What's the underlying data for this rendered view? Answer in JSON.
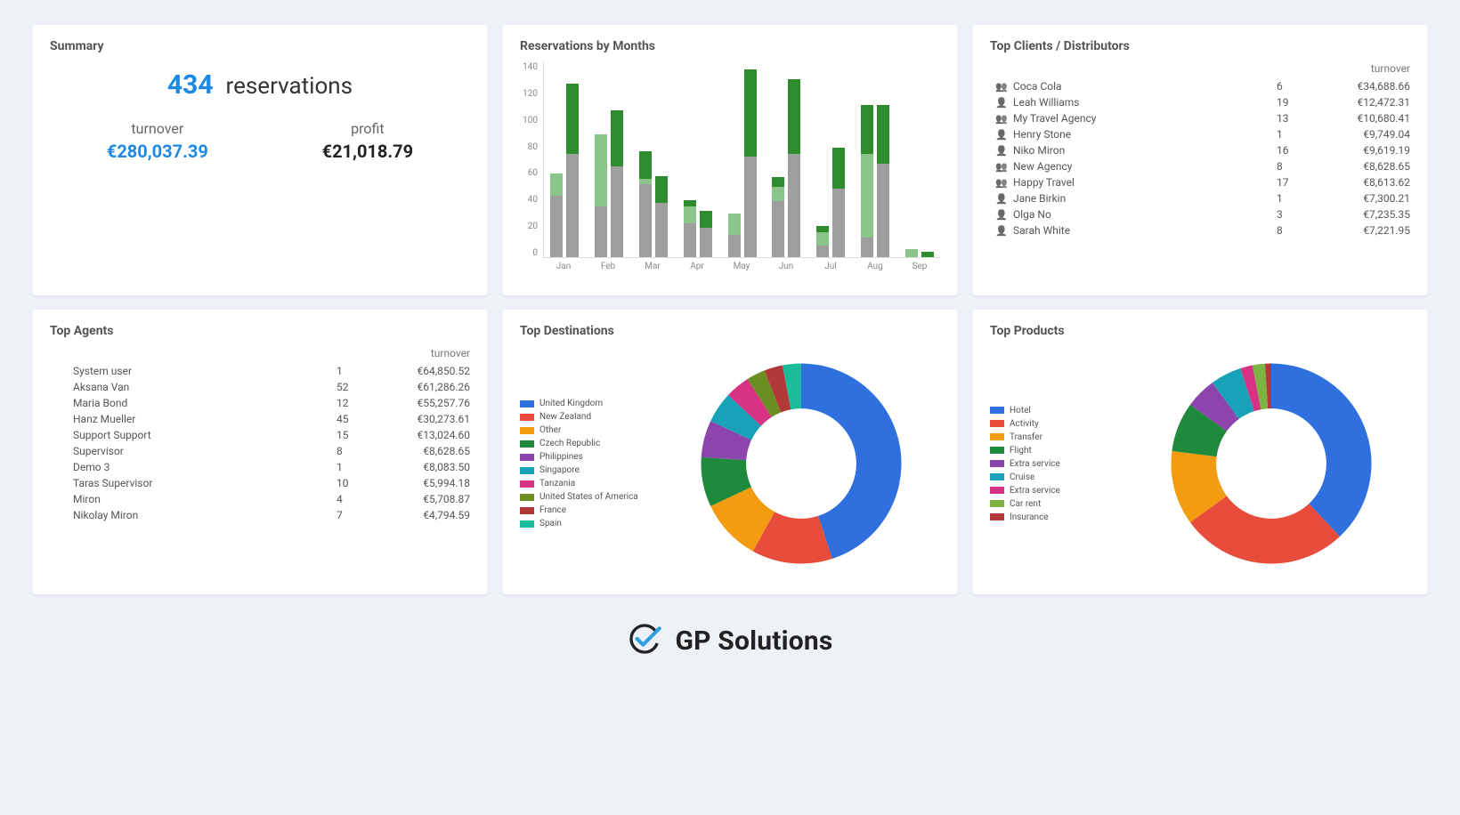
{
  "summary": {
    "title": "Summary",
    "reservations_count": "434",
    "reservations_label": "reservations",
    "turnover_label": "turnover",
    "turnover_value": "€280,037.39",
    "profit_label": "profit",
    "profit_value": "€21,018.79"
  },
  "reservations_chart_title": "Reservations by Months",
  "clients": {
    "title": "Top Clients / Distributors",
    "col_turnover": "turnover",
    "items": [
      {
        "icon": "people",
        "name": "Coca Cola",
        "count": "6",
        "turnover": "€34,688.66"
      },
      {
        "icon": "person",
        "name": "Leah Williams",
        "count": "19",
        "turnover": "€12,472.31"
      },
      {
        "icon": "people",
        "name": "My Travel Agency",
        "count": "13",
        "turnover": "€10,680.41"
      },
      {
        "icon": "person",
        "name": "Henry Stone",
        "count": "1",
        "turnover": "€9,749.04"
      },
      {
        "icon": "person",
        "name": "Niko Miron",
        "count": "16",
        "turnover": "€9,619.19"
      },
      {
        "icon": "people",
        "name": "New Agency",
        "count": "8",
        "turnover": "€8,628.65"
      },
      {
        "icon": "people",
        "name": "Happy Travel",
        "count": "17",
        "turnover": "€8,613.62"
      },
      {
        "icon": "person",
        "name": "Jane Birkin",
        "count": "1",
        "turnover": "€7,300.21"
      },
      {
        "icon": "person",
        "name": "Olga No",
        "count": "3",
        "turnover": "€7,235.35"
      },
      {
        "icon": "person",
        "name": "Sarah White",
        "count": "8",
        "turnover": "€7,221.95"
      }
    ]
  },
  "agents": {
    "title": "Top Agents",
    "col_turnover": "turnover",
    "items": [
      {
        "name": "System user",
        "count": "1",
        "turnover": "€64,850.52"
      },
      {
        "name": "Aksana Van",
        "count": "52",
        "turnover": "€61,286.26"
      },
      {
        "name": "Maria Bond",
        "count": "12",
        "turnover": "€55,257.76"
      },
      {
        "name": "Hanz Mueller",
        "count": "45",
        "turnover": "€30,273.61"
      },
      {
        "name": "Support Support",
        "count": "15",
        "turnover": "€13,024.60"
      },
      {
        "name": "Supervisor",
        "count": "8",
        "turnover": "€8,628.65"
      },
      {
        "name": "Demo 3",
        "count": "1",
        "turnover": "€8,083.50"
      },
      {
        "name": "Taras Supervisor",
        "count": "10",
        "turnover": "€5,994.18"
      },
      {
        "name": "Miron",
        "count": "4",
        "turnover": "€5,708.87"
      },
      {
        "name": "Nikolay Miron",
        "count": "7",
        "turnover": "€4,794.59"
      }
    ]
  },
  "destinations": {
    "title": "Top Destinations",
    "legend": [
      "United Kingdom",
      "New Zealand",
      "Other",
      "Czech Republic",
      "Philippines",
      "Singapore",
      "Tanzania",
      "United States of America",
      "France",
      "Spain"
    ]
  },
  "products": {
    "title": "Top Products",
    "legend": [
      "Hotel",
      "Activity",
      "Transfer",
      "Flight",
      "Extra service",
      "Cruise",
      "Extra service",
      "Car rent",
      "Insurance"
    ]
  },
  "footer_brand": "GP Solutions",
  "chart_data": [
    {
      "type": "bar",
      "title": "Reservations by Months",
      "xlabel": "",
      "ylabel": "",
      "ylim": [
        0,
        140
      ],
      "yticks": [
        0,
        20,
        40,
        60,
        80,
        100,
        120,
        140
      ],
      "categories": [
        "Jan",
        "Feb",
        "Mar",
        "Apr",
        "May",
        "Jun",
        "Jul",
        "Aug",
        "Sep"
      ],
      "stacked": true,
      "groups_per_category": 2,
      "series": [
        {
          "name": "g1-bottom",
          "color": "#9e9e9e",
          "values": [
            [
              44,
              74
            ],
            [
              36,
              65
            ],
            [
              52,
              39
            ],
            [
              24,
              21
            ],
            [
              16,
              72
            ],
            [
              40,
              74
            ],
            [
              8,
              49
            ],
            [
              14,
              67
            ],
            [
              0,
              0
            ]
          ]
        },
        {
          "name": "g1-mid",
          "color": "#8bc58b",
          "values": [
            [
              16,
              0
            ],
            [
              52,
              0
            ],
            [
              4,
              0
            ],
            [
              12,
              0
            ],
            [
              15,
              0
            ],
            [
              10,
              0
            ],
            [
              10,
              0
            ],
            [
              60,
              0
            ],
            [
              6,
              0
            ]
          ]
        },
        {
          "name": "g1-top",
          "color": "#2e8b2e",
          "values": [
            [
              0,
              50
            ],
            [
              0,
              40
            ],
            [
              20,
              19
            ],
            [
              5,
              12
            ],
            [
              0,
              62
            ],
            [
              7,
              53
            ],
            [
              4,
              29
            ],
            [
              35,
              42
            ],
            [
              0,
              4
            ]
          ]
        }
      ],
      "note": "Each month has two stacked bars (group1, group2). values[i] = [group1_value, group2_value]. Stacks read bottom→top (grey, light-green, dark-green). Values estimated from axis gridlines."
    },
    {
      "type": "pie",
      "title": "Top Destinations",
      "hole": 0.55,
      "palette": [
        "#2f6fde",
        "#e84c3d",
        "#f39c12",
        "#1f8a3b",
        "#8e44ad",
        "#17a2b8",
        "#d63384",
        "#6b8e23",
        "#b33939",
        "#1abc9c"
      ],
      "data": [
        {
          "label": "United Kingdom",
          "value": 45
        },
        {
          "label": "New Zealand",
          "value": 13
        },
        {
          "label": "Other",
          "value": 10
        },
        {
          "label": "Czech Republic",
          "value": 8
        },
        {
          "label": "Philippines",
          "value": 6
        },
        {
          "label": "Singapore",
          "value": 5
        },
        {
          "label": "Tanzania",
          "value": 4
        },
        {
          "label": "United States of America",
          "value": 3
        },
        {
          "label": "France",
          "value": 3
        },
        {
          "label": "Spain",
          "value": 3
        }
      ],
      "note": "Percentages estimated from slice arc in screenshot."
    },
    {
      "type": "pie",
      "title": "Top Products",
      "hole": 0.55,
      "palette": [
        "#2f6fde",
        "#e84c3d",
        "#f39c12",
        "#1f8a3b",
        "#8e44ad",
        "#17a2b8",
        "#d63384",
        "#7cb342",
        "#b33939"
      ],
      "data": [
        {
          "label": "Hotel",
          "value": 38
        },
        {
          "label": "Activity",
          "value": 27
        },
        {
          "label": "Transfer",
          "value": 12
        },
        {
          "label": "Flight",
          "value": 8
        },
        {
          "label": "Extra service",
          "value": 5
        },
        {
          "label": "Cruise",
          "value": 5
        },
        {
          "label": "Extra service",
          "value": 2
        },
        {
          "label": "Car rent",
          "value": 2
        },
        {
          "label": "Insurance",
          "value": 1
        }
      ],
      "note": "Percentages estimated from slice arc in screenshot."
    }
  ]
}
